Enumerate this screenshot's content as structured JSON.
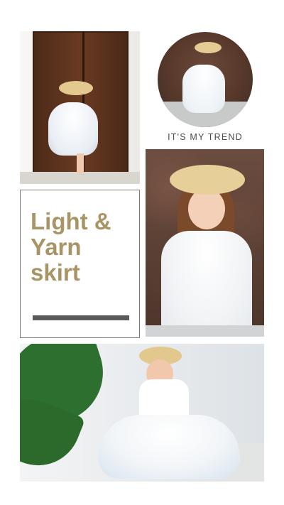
{
  "trend_label": "IT'S MY TREND",
  "card": {
    "line1": "Light &",
    "line2": "Yarn",
    "line3": "skirt"
  }
}
